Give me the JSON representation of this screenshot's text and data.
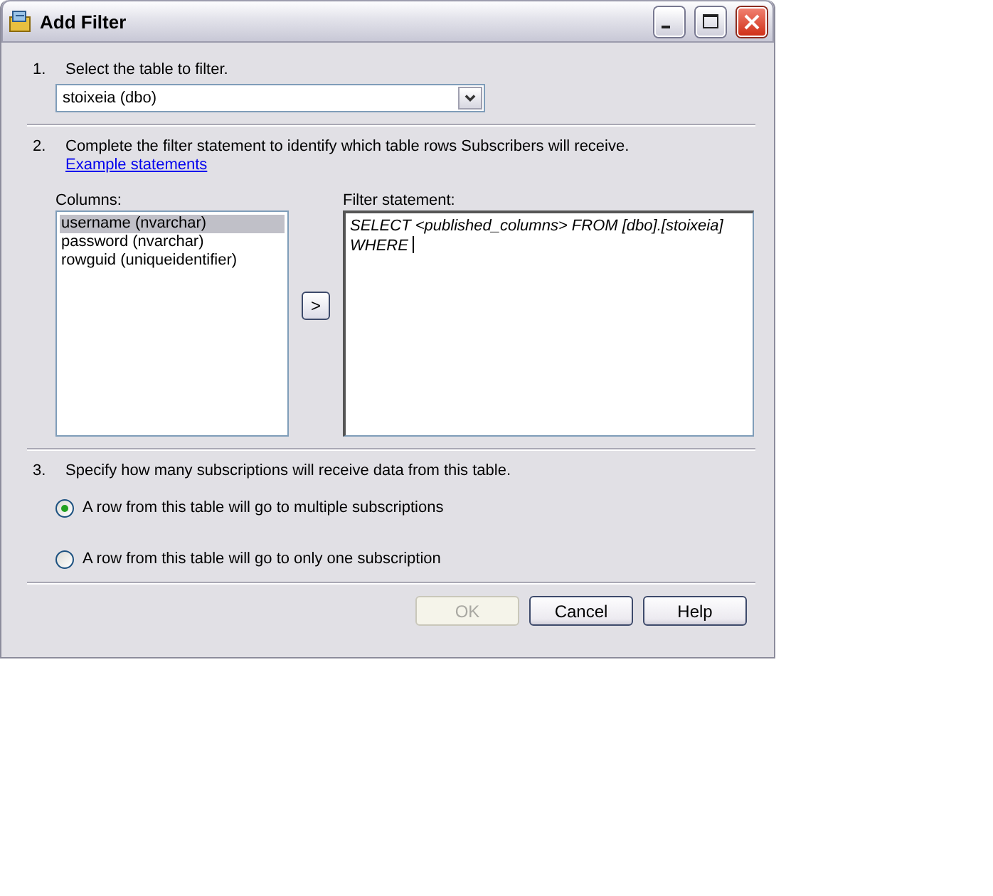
{
  "window": {
    "title": "Add Filter"
  },
  "step_1": {
    "number": "1.",
    "label": "Select the table to filter.",
    "table_select": {
      "value": "stoixeia (dbo)"
    }
  },
  "step_2": {
    "number": "2.",
    "text": "Complete the filter statement to identify which table rows Subscribers will receive.",
    "link": "Example statements",
    "columns_label": "Columns:",
    "columns": [
      {
        "label": "username (nvarchar)",
        "selected": true
      },
      {
        "label": "password (nvarchar)",
        "selected": false
      },
      {
        "label": "rowguid (uniqueidentifier)",
        "selected": false
      }
    ],
    "add_button": ">",
    "filter_label": "Filter statement:",
    "filter_statement": {
      "value": "SELECT <published_columns> FROM [dbo].[stoixeia]\nWHERE "
    }
  },
  "step_3": {
    "number": "3.",
    "label": "Specify how many subscriptions will receive data from this table.",
    "options": [
      {
        "label": "A row from this table will go to multiple subscriptions",
        "selected": true
      },
      {
        "label": "A row from this table will go to only one subscription",
        "selected": false
      }
    ]
  },
  "buttons": [
    {
      "label": "OK",
      "disabled": true
    },
    {
      "label": "Cancel",
      "disabled": false
    },
    {
      "label": "Help",
      "disabled": false
    }
  ]
}
